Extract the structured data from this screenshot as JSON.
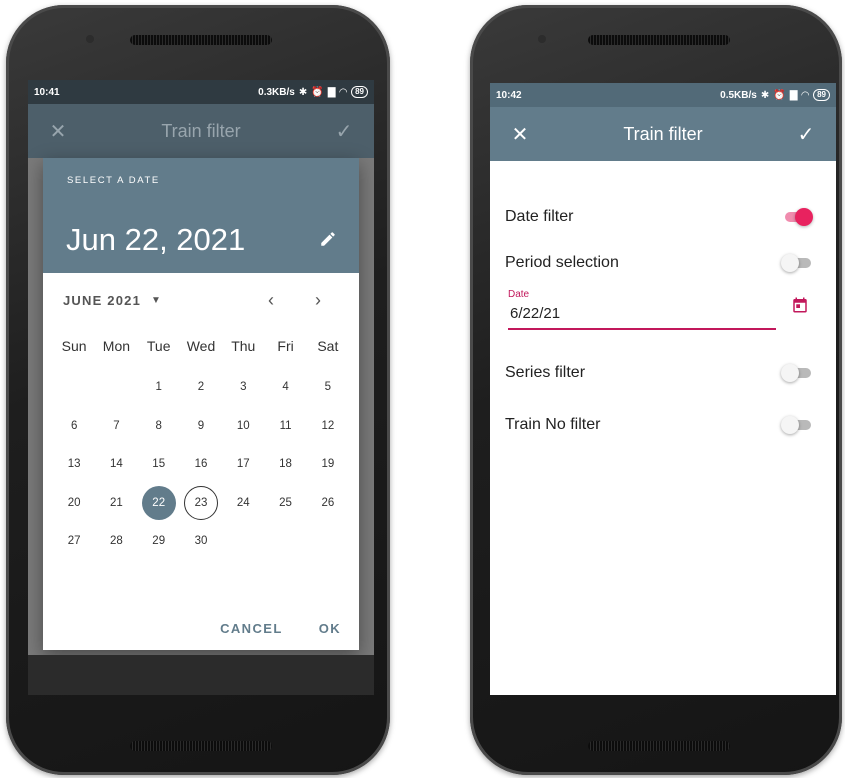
{
  "left_screen": {
    "status": {
      "time": "10:41",
      "speed": "0.3KB/s",
      "battery": "89"
    },
    "appbar": {
      "title": "Train filter",
      "close_icon": "close-icon",
      "confirm_icon": "check-icon"
    },
    "dialog": {
      "header_label": "SELECT A DATE",
      "selected_date": "Jun 22, 2021",
      "edit_icon": "pencil-icon",
      "month_label": "JUNE 2021",
      "prev_icon": "chevron-left-icon",
      "next_icon": "chevron-right-icon",
      "weekdays": [
        "Sun",
        "Mon",
        "Tue",
        "Wed",
        "Thu",
        "Fri",
        "Sat"
      ],
      "days": [
        "",
        "",
        "1",
        "2",
        "3",
        "4",
        "5",
        "6",
        "7",
        "8",
        "9",
        "10",
        "11",
        "12",
        "13",
        "14",
        "15",
        "16",
        "17",
        "18",
        "19",
        "20",
        "21",
        "22",
        "23",
        "24",
        "25",
        "26",
        "27",
        "28",
        "29",
        "30",
        "",
        "",
        ""
      ],
      "selected_day": "22",
      "today_day": "23",
      "cancel_label": "CANCEL",
      "ok_label": "OK"
    }
  },
  "right_screen": {
    "status": {
      "time": "10:42",
      "speed": "0.5KB/s",
      "battery": "89"
    },
    "appbar": {
      "title": "Train filter",
      "close_icon": "close-icon",
      "confirm_icon": "check-icon"
    },
    "filters": {
      "date_filter": {
        "label": "Date filter",
        "on": true
      },
      "period_selection": {
        "label": "Period selection",
        "on": false
      },
      "date_field": {
        "label": "Date",
        "value": "6/22/21"
      },
      "series_filter": {
        "label": "Series filter",
        "on": false
      },
      "train_no_filter": {
        "label": "Train No filter",
        "on": false
      }
    }
  },
  "colors": {
    "primary": "#627c8b",
    "accent": "#e8225f",
    "field_underline": "#c2185b"
  }
}
